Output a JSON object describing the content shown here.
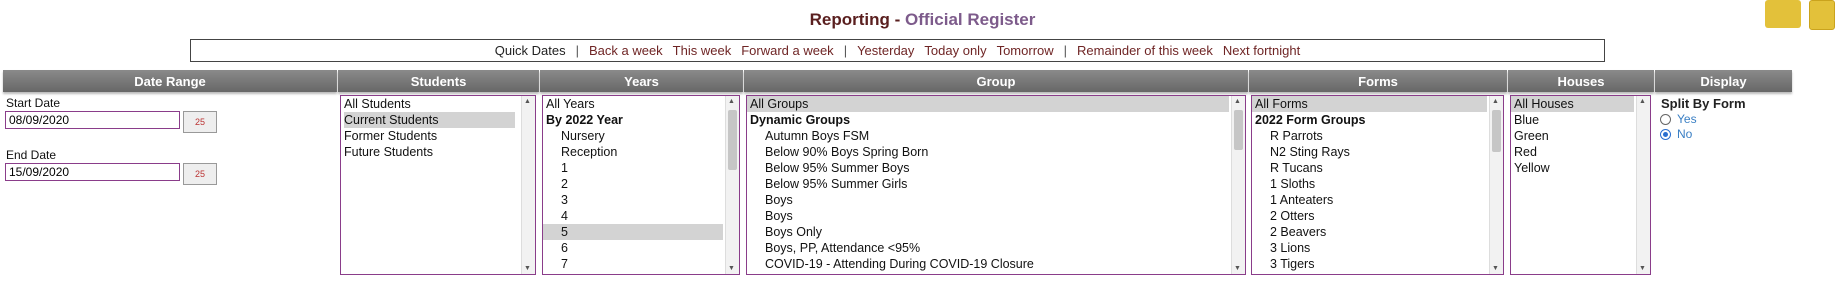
{
  "header": {
    "title_prefix": "Reporting - ",
    "title_main": "Official Register"
  },
  "quick_dates": {
    "label": "Quick Dates",
    "sep": "|",
    "links": [
      "Back a week",
      "This week",
      "Forward a week",
      "Yesterday",
      "Today only",
      "Tomorrow",
      "Remainder of this week",
      "Next fortnight"
    ]
  },
  "columns": {
    "date_range": "Date Range",
    "students": "Students",
    "years": "Years",
    "group": "Group",
    "forms": "Forms",
    "houses": "Houses",
    "display": "Display"
  },
  "date_range": {
    "start_label": "Start Date",
    "start_value": "08/09/2020",
    "end_label": "End Date",
    "end_value": "15/09/2020",
    "cal_icon_text": "25"
  },
  "students": {
    "items": [
      "All Students",
      "Current Students",
      "Former Students",
      "Future Students"
    ]
  },
  "years": {
    "items": [
      "All Years",
      "By 2022 Year",
      "Nursery",
      "Reception",
      "1",
      "2",
      "3",
      "4",
      "5",
      "6",
      "7"
    ]
  },
  "group": {
    "items": [
      "All Groups",
      "Dynamic Groups",
      "Autumn Boys FSM",
      "Below 90% Boys Spring Born",
      "Below 95% Summer Boys",
      "Below 95% Summer Girls",
      "Boys",
      "Boys",
      "Boys Only",
      "Boys, PP, Attendance <95%",
      "COVID-19 - Attending During COVID-19 Closure"
    ]
  },
  "forms": {
    "items": [
      "All Forms",
      "2022 Form Groups",
      "R Parrots",
      "N2 Sting Rays",
      "R Tucans",
      "1 Sloths",
      "1 Anteaters",
      "2 Otters",
      "2 Beavers",
      "3 Lions",
      "3 Tigers"
    ]
  },
  "houses": {
    "items": [
      "All Houses",
      "Blue",
      "Green",
      "Red",
      "Yellow"
    ]
  },
  "display": {
    "split_label": "Split By Form",
    "yes": "Yes",
    "no": "No",
    "selected": "No"
  }
}
